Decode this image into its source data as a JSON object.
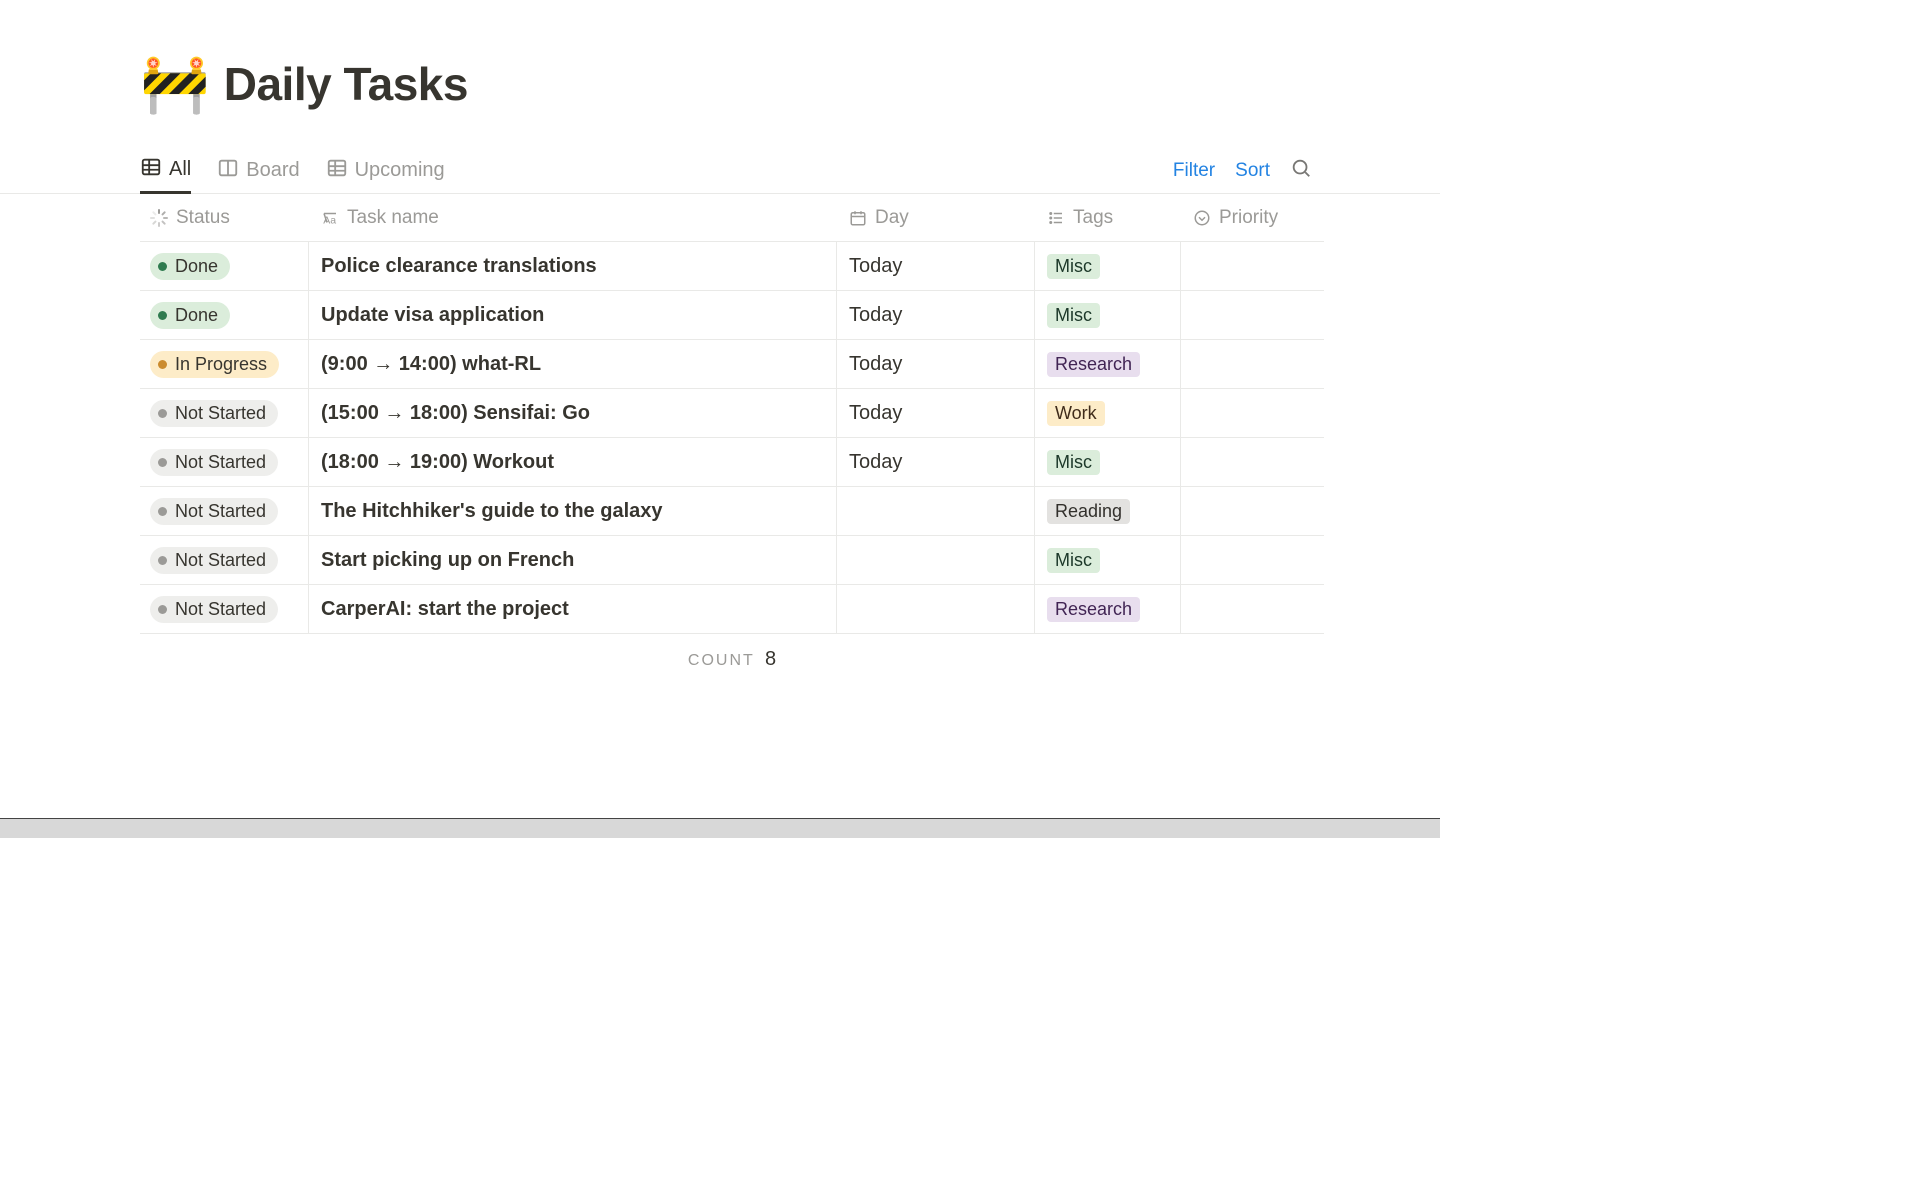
{
  "page": {
    "icon": "🚧",
    "title": "Daily Tasks"
  },
  "views": {
    "active": 0,
    "tabs": [
      {
        "label": "All",
        "icon": "table"
      },
      {
        "label": "Board",
        "icon": "board"
      },
      {
        "label": "Upcoming",
        "icon": "table"
      }
    ]
  },
  "toolbar": {
    "filter": "Filter",
    "sort": "Sort"
  },
  "columns": {
    "status": "Status",
    "task": "Task name",
    "day": "Day",
    "tags": "Tags",
    "priority": "Priority"
  },
  "rows": [
    {
      "status": "Done",
      "task": "Police clearance translations",
      "day": "Today",
      "tag": "Misc",
      "status_kind": "done"
    },
    {
      "status": "Done",
      "task": "Update visa application",
      "day": "Today",
      "tag": "Misc",
      "status_kind": "done"
    },
    {
      "status": "In Progress",
      "task": "(9:00 → 14:00) what-RL",
      "day": "Today",
      "tag": "Research",
      "status_kind": "progress"
    },
    {
      "status": "Not Started",
      "task": "(15:00 → 18:00) Sensifai: Go",
      "day": "Today",
      "tag": "Work",
      "status_kind": "notstarted"
    },
    {
      "status": "Not Started",
      "task": "(18:00 → 19:00) Workout",
      "day": "Today",
      "tag": "Misc",
      "status_kind": "notstarted"
    },
    {
      "status": "Not Started",
      "task": "The Hitchhiker's guide to the galaxy",
      "day": "",
      "tag": "Reading",
      "status_kind": "notstarted"
    },
    {
      "status": "Not Started",
      "task": "Start picking up on French",
      "day": "",
      "tag": "Misc",
      "status_kind": "notstarted"
    },
    {
      "status": "Not Started",
      "task": "CarperAI: start the project",
      "day": "",
      "tag": "Research",
      "status_kind": "notstarted"
    }
  ],
  "footer": {
    "count_label": "COUNT",
    "count_value": "8"
  },
  "tag_colors": {
    "Misc": "misc",
    "Research": "research",
    "Work": "work",
    "Reading": "reading"
  }
}
